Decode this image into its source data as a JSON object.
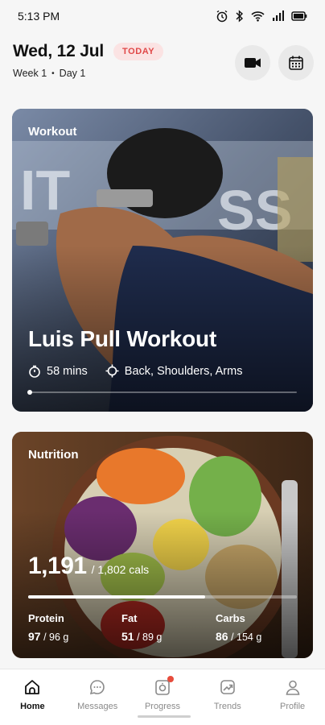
{
  "status_bar": {
    "time": "5:13 PM",
    "icons": [
      "alarm-icon",
      "bluetooth-icon",
      "wifi-icon",
      "signal-icon",
      "battery-icon"
    ]
  },
  "header": {
    "date": "Wed, 12 Jul",
    "today_badge": "TODAY",
    "week": "Week 1",
    "separator": "•",
    "day": "Day 1",
    "buttons": [
      "video-camera-icon",
      "calendar-icon"
    ]
  },
  "workout": {
    "label": "Workout",
    "title": "Luis Pull Workout",
    "duration": "58 mins",
    "muscles": "Back, Shoulders, Arms",
    "icons": [
      "stopwatch-icon",
      "target-icon"
    ]
  },
  "nutrition": {
    "label": "Nutrition",
    "calories": "1,191",
    "calories_target": "/ 1,802 cals",
    "calorie_progress": 0.66,
    "macros": [
      {
        "label": "Protein",
        "value": "97",
        "target": "/ 96 g"
      },
      {
        "label": "Fat",
        "value": "51",
        "target": "/ 89 g"
      },
      {
        "label": "Carbs",
        "value": "86",
        "target": "/ 154 g"
      }
    ]
  },
  "nav": {
    "items": [
      {
        "label": "Home",
        "icon": "home-icon",
        "active": true
      },
      {
        "label": "Messages",
        "icon": "chat-bubble-icon",
        "active": false
      },
      {
        "label": "Progress",
        "icon": "camera-icon",
        "active": false,
        "notification": true
      },
      {
        "label": "Trends",
        "icon": "trend-chart-icon",
        "active": false
      },
      {
        "label": "Profile",
        "icon": "person-icon",
        "active": false
      }
    ]
  },
  "colors": {
    "accent_red": "#e04848",
    "badge_bg": "#fbe3e3",
    "notification": "#e74c3c"
  }
}
